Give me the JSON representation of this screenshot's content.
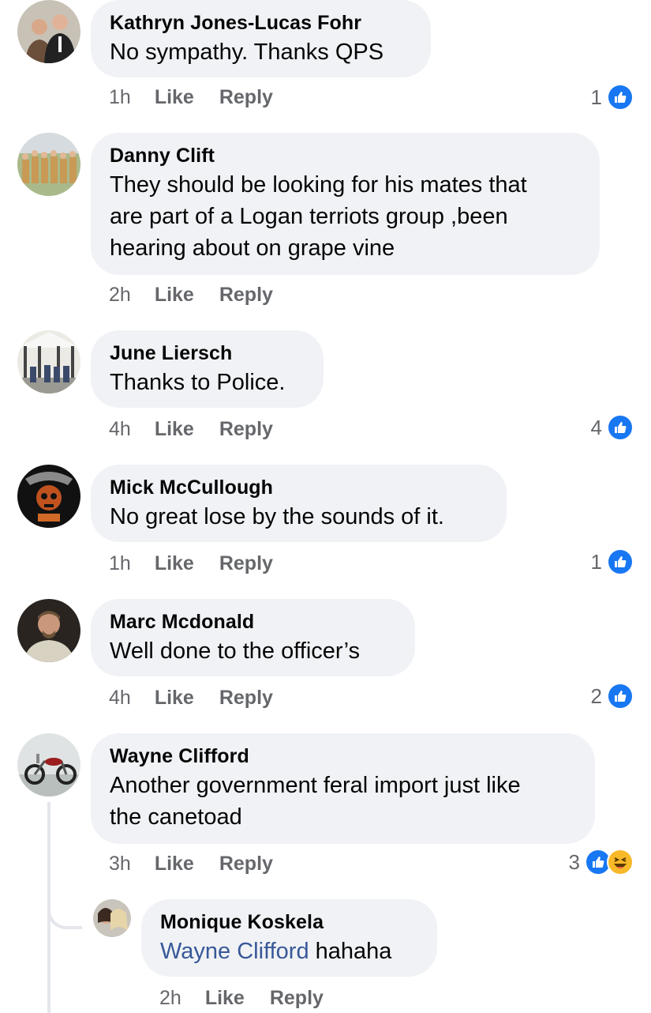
{
  "comments": [
    {
      "author": "Kathryn Jones-Lucas Fohr",
      "text": "No sympathy. Thanks QPS",
      "time": "1h",
      "like": "Like",
      "reply": "Reply",
      "reaction_count": "1"
    },
    {
      "author": "Danny Clift",
      "text_lines": [
        "They should be looking for his mates that",
        "are part of a Logan terriots  group ,been",
        "hearing about  on grape vine"
      ],
      "time": "2h",
      "like": "Like",
      "reply": "Reply"
    },
    {
      "author": "June Liersch",
      "text": "Thanks to Police.",
      "time": "4h",
      "like": "Like",
      "reply": "Reply",
      "reaction_count": "4"
    },
    {
      "author": "Mick McCullough",
      "text": "No great lose by the sounds of it.",
      "time": "1h",
      "like": "Like",
      "reply": "Reply",
      "reaction_count": "1"
    },
    {
      "author": "Marc Mcdonald",
      "text": "Well done to the officer’s",
      "time": "4h",
      "like": "Like",
      "reply": "Reply",
      "reaction_count": "2"
    },
    {
      "author": "Wayne Clifford",
      "text_lines": [
        "Another government feral import just like",
        "the canetoad"
      ],
      "time": "3h",
      "like": "Like",
      "reply": "Reply",
      "reaction_count": "3"
    }
  ],
  "reply": {
    "author": "Monique Koskela",
    "mention": "Wayne Clifford",
    "text": " hahaha",
    "time": "2h",
    "like": "Like",
    "reply": "Reply"
  },
  "colors": {
    "bubble": "#f0f2f5",
    "like_blue": "#1877f2",
    "meta_grey": "#65676b",
    "mention": "#385898",
    "haha": "#f7b928"
  },
  "icons": {
    "like": "thumbs-up-reaction-icon",
    "haha": "laughing-face-reaction-icon"
  }
}
